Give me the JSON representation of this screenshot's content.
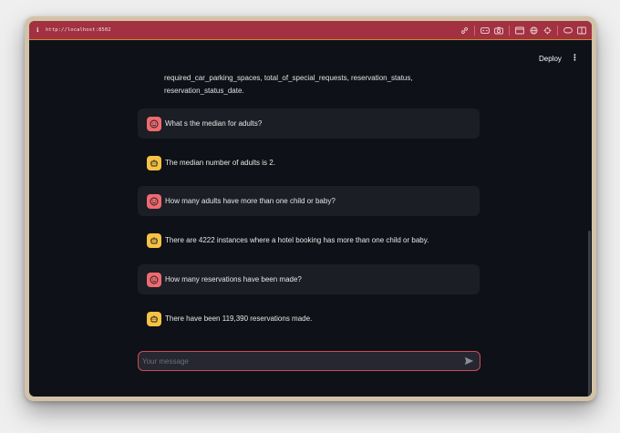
{
  "browser": {
    "url": "http://localhost:8502",
    "info_icon": "info-icon",
    "icons": [
      "link-icon",
      "gamepad-icon",
      "camera-icon",
      "window-icon",
      "globe-icon",
      "crosshair-icon",
      "comment-icon",
      "split-view-icon"
    ]
  },
  "header": {
    "deploy_label": "Deploy",
    "menu_icon": "more-vertical-icon"
  },
  "chat": {
    "pre_text_lines": [
      "required_car_parking_spaces, total_of_special_requests, reservation_status,",
      "reservation_status_date."
    ],
    "messages": [
      {
        "role": "user",
        "avatar": "smile-face-icon",
        "text": "What s the median for adults?"
      },
      {
        "role": "assistant",
        "avatar": "robot-icon",
        "text": "The median number of adults is 2."
      },
      {
        "role": "user",
        "avatar": "smile-face-icon",
        "text": "How many adults have more than one child or baby?"
      },
      {
        "role": "assistant",
        "avatar": "robot-icon",
        "text": "There are 4222 instances where a hotel booking has more than one child or baby."
      },
      {
        "role": "user",
        "avatar": "smile-face-icon",
        "text": "How many reservations have been made?"
      },
      {
        "role": "assistant",
        "avatar": "robot-icon",
        "text": "There have been 119,390 reservations made."
      }
    ]
  },
  "input": {
    "placeholder": "Your message",
    "value": "",
    "send_icon": "send-icon"
  },
  "colors": {
    "toolbar": "#a23142",
    "app_background": "#0e1117",
    "user_avatar": "#ef6a6f",
    "assistant_avatar": "#f7c244",
    "input_border": "#cf4b5a"
  }
}
